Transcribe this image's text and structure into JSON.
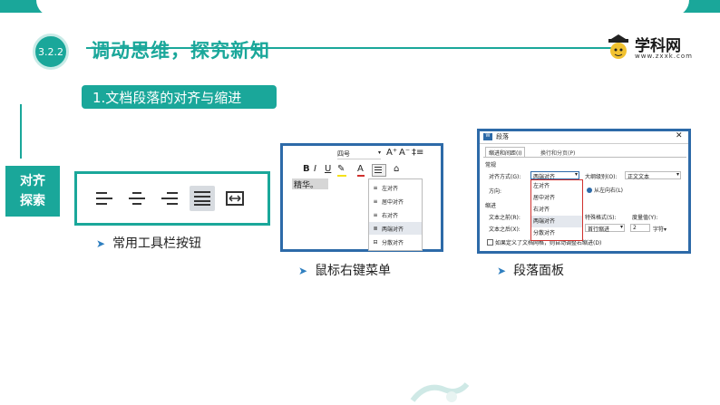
{
  "header": {
    "section_number": "3.2.2",
    "title": "调动思维，探究新知",
    "logo_text": "学科网",
    "logo_url": "www.zxxk.com"
  },
  "subtitle": "1.文档段落的对齐与缩进",
  "side_tag": {
    "line1": "对齐",
    "line2": "探索"
  },
  "toolbar": {
    "caption": "常用工具栏按钮",
    "buttons": [
      "align-left",
      "align-center",
      "align-right",
      "align-justify",
      "align-distributed"
    ]
  },
  "context_menu": {
    "caption": "鼠标右键菜单",
    "font_size": "四号",
    "text_sample": "精华。",
    "items": [
      "左对齐",
      "居中对齐",
      "右对齐",
      "两端对齐",
      "分散对齐"
    ]
  },
  "paragraph_dialog": {
    "caption": "段落面板",
    "title": "段落",
    "tabs": [
      "缩进和间距(I)",
      "换行和分页(P)"
    ],
    "section_general": "常规",
    "align_label": "对齐方式(G):",
    "align_value": "两端对齐",
    "outline_label": "大纲级别(O):",
    "outline_value": "正文文本",
    "direction_label": "方向:",
    "rtl_option": "从左向右(L)",
    "dropdown_options": [
      "左对齐",
      "居中对齐",
      "右对齐",
      "两端对齐",
      "分散对齐"
    ],
    "section_indent": "缩进",
    "indent_before_label": "文本之前(R):",
    "indent_after_label": "文本之后(X):",
    "special_label": "特殊格式(S):",
    "special_value": "首行缩进",
    "measure_label": "度量值(Y):",
    "measure_value": "2",
    "measure_unit": "字符",
    "grid_checkbox_label": "如果定义了文档网格，则自动调整右缩进(D)"
  },
  "colors": {
    "accent": "#1aa79a",
    "frame_blue": "#2d6aa8"
  }
}
